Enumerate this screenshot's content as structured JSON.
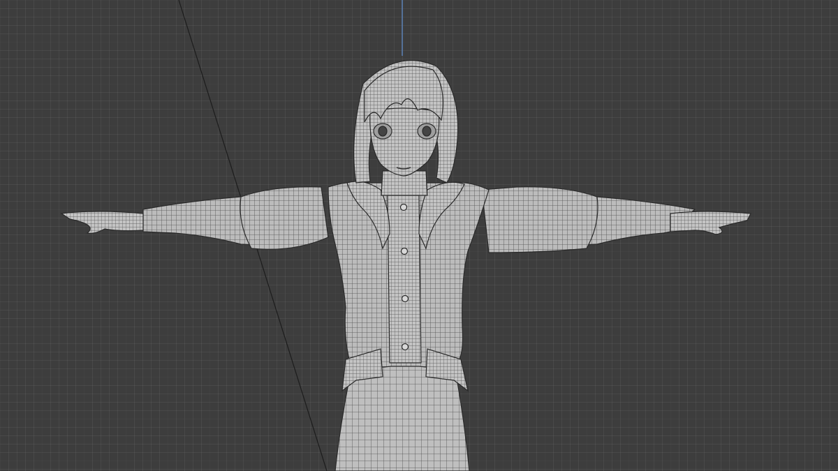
{
  "viewport": {
    "mode": "wireframe-overlay",
    "background_color": "#3d3d3d",
    "z_axis_color": "#5b80b5",
    "mesh_color": "#bdbdbd",
    "wire_color": "#4a4a4a"
  },
  "scene": {
    "object": "character-mesh",
    "pose": "T-pose"
  }
}
